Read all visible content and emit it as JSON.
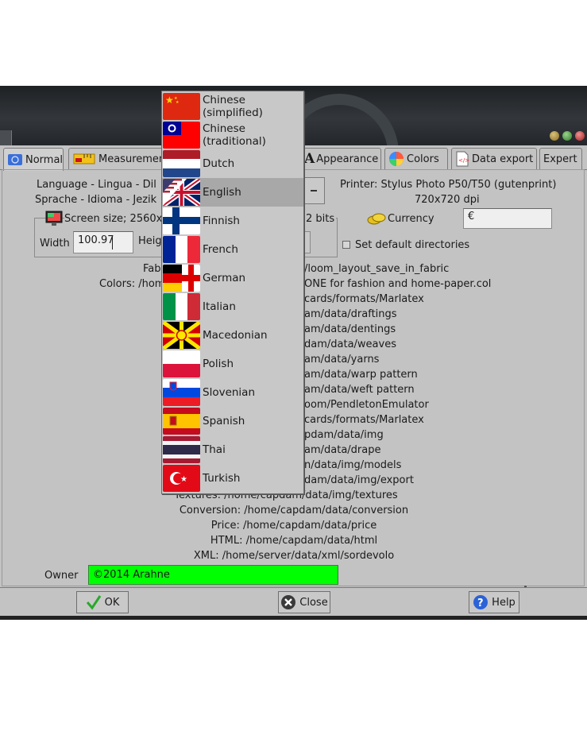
{
  "tabs": [
    {
      "label": "Normal",
      "icon": "flag-tab-icon"
    },
    {
      "label": "Measurements",
      "icon": "ruler-icon"
    },
    {
      "label": "Appearance",
      "icon": "font-a-icon"
    },
    {
      "label": "Colors",
      "icon": "color-wheel-icon"
    },
    {
      "label": "Data export",
      "icon": "html-file-icon"
    },
    {
      "label": "Expert",
      "icon": ""
    }
  ],
  "language": {
    "line1": "Language - Lingua - Dil",
    "line2": "Sprache - Idioma - Jezik"
  },
  "printer": {
    "line1": "Printer: Stylus Photo P50/T50 (gutenprint)",
    "line2": "720x720 dpi"
  },
  "screen": {
    "group_label": "Screen size; 2560x",
    "bits": "2 bits",
    "width_label": "Width",
    "width_value": "100.97",
    "height_label": "Heig"
  },
  "currency": {
    "label": "Currency",
    "value": "€"
  },
  "default_dirs": {
    "label": "Set default directories",
    "checked": false
  },
  "paths_left": {
    "fabric": "Fab",
    "colors": "Colors: /hom"
  },
  "paths": [
    "/loom_layout_save_in_fabric",
    "ONE for fashion and home-paper.col",
    "cards/formats/Marlatex",
    "am/data/draftings",
    "am/data/dentings",
    "dam/data/weaves",
    "am/data/yarns",
    "am/data/warp pattern",
    "am/data/weft pattern",
    "oom/PendletonEmulator",
    "cards/formats/Marlatex",
    "pdam/data/img",
    "am/data/drape",
    "n/data/img/models",
    "dam/data/img/export",
    "Textures: /home/capdam/data/img/textures",
    "Conversion: /home/capdam/data/conversion",
    "Price: /home/capdam/data/price",
    "HTML: /home/capdam/data/html",
    "XML: /home/server/data/xml/sordevolo"
  ],
  "owner": {
    "label": "Owner",
    "value": "©2014 Arahne"
  },
  "buttons": {
    "ok": "OK",
    "close": "Close",
    "help": "Help"
  },
  "languages": [
    {
      "label": "Chinese (simplified)",
      "flag": "china"
    },
    {
      "label": "Chinese (traditional)",
      "flag": "taiwan"
    },
    {
      "label": "Dutch",
      "flag": "netherlands"
    },
    {
      "label": "English",
      "flag": "us-uk",
      "selected": true
    },
    {
      "label": "Finnish",
      "flag": "finland"
    },
    {
      "label": "French",
      "flag": "france"
    },
    {
      "label": "German",
      "flag": "germany"
    },
    {
      "label": "Italian",
      "flag": "italy"
    },
    {
      "label": "Macedonian",
      "flag": "macedonia"
    },
    {
      "label": "Polish",
      "flag": "poland"
    },
    {
      "label": "Slovenian",
      "flag": "slovenia"
    },
    {
      "label": "Spanish",
      "flag": "spain"
    },
    {
      "label": "Thai",
      "flag": "thailand"
    },
    {
      "label": "Turkish",
      "flag": "turkey"
    }
  ],
  "colors": {
    "owner_field": "#00ff00",
    "dialog": "#c3c3c3",
    "selected_item": "#a8a8a8"
  }
}
